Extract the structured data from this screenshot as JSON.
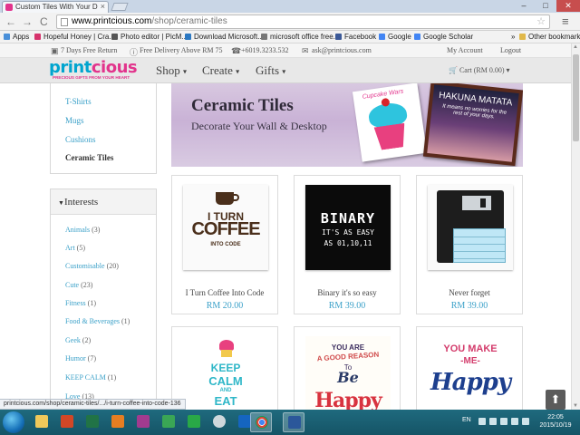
{
  "browser": {
    "tab_title": "Custom Tiles With Your D",
    "tab_close": "×",
    "win_min": "–",
    "win_max": "□",
    "win_close": "✕",
    "nav_back": "←",
    "nav_forward": "→",
    "nav_reload": "C",
    "url_host": "www.printcious.com",
    "url_path": "/shop/ceramic-tiles",
    "star": "☆",
    "menu": "≡",
    "bookmarks": [
      {
        "label": "Apps",
        "color": "#4a90d9"
      },
      {
        "label": "Hopeful Honey | Cra...",
        "color": "#d6336c"
      },
      {
        "label": "Photo editor | PicM...",
        "color": "#555555"
      },
      {
        "label": "Download Microsoft...",
        "color": "#2b78c2"
      },
      {
        "label": "microsoft office free...",
        "color": "#777777"
      },
      {
        "label": "Facebook",
        "color": "#3b5998"
      },
      {
        "label": "Google",
        "color": "#4285f4"
      },
      {
        "label": "Google Scholar",
        "color": "#4285f4"
      }
    ],
    "bm_overflow": "»",
    "other_bookmarks": "Other bookmarks",
    "status_url": "printcious.com/shop/ceramic-tiles/.../i-turn-coffee-into-code-136"
  },
  "topbar": {
    "return": "7 Days Free Return",
    "delivery": "Free Delivery Above RM 75",
    "phone": "+6019.3233.532",
    "email": "ask@printcious.com",
    "account": "My Account",
    "logout": "Logout"
  },
  "header": {
    "logo_main": "print",
    "logo_accent": "cious",
    "logo_tag": "PRECIOUS GIFTS FROM YOUR HEART",
    "nav_shop": "Shop",
    "nav_create": "Create",
    "nav_gifts": "Gifts",
    "cart": "Cart (RM 0.00)"
  },
  "sidebar": {
    "categories": [
      "T-Shirts",
      "Mugs",
      "Cushions",
      "Ceramic Tiles"
    ],
    "interests_title": "Interests",
    "interests": [
      {
        "label": "Animals",
        "count": "(3)"
      },
      {
        "label": "Art",
        "count": "(5)"
      },
      {
        "label": "Customisable",
        "count": "(20)"
      },
      {
        "label": "Cute",
        "count": "(23)"
      },
      {
        "label": "Fitness",
        "count": "(1)"
      },
      {
        "label": "Food & Beverages",
        "count": "(1)"
      },
      {
        "label": "Geek",
        "count": "(2)"
      },
      {
        "label": "Humor",
        "count": "(7)"
      },
      {
        "label": "KEEP CALM",
        "count": "(1)"
      },
      {
        "label": "Love",
        "count": "(13)"
      }
    ]
  },
  "banner": {
    "title": "Ceramic Tiles",
    "subtitle": "Decorate Your Wall & Desktop",
    "tile_caption": "Cupcake Wars",
    "frame_title": "HAKUNA MATATA",
    "frame_small": "It means no worries for the rest of your days."
  },
  "products": [
    {
      "name": "I Turn Coffee Into Code",
      "price": "RM 20.00"
    },
    {
      "name": "Binary it's so easy",
      "price": "RM 39.00"
    },
    {
      "name": "Never forget",
      "price": "RM 39.00"
    }
  ],
  "tiles": {
    "coffee_l1": "I TURN",
    "coffee_l2": "COFFEE",
    "coffee_l3": "INTO CODE",
    "binary_l1": "BINARY",
    "binary_l2": "IT'S AS EASY",
    "binary_l3": "AS 01,10,11",
    "keep_l1": "KEEP",
    "keep_l2": "CALM",
    "keep_l3": "AND",
    "keep_l4": "EAT",
    "reason_l1": "YOU ARE",
    "reason_l2": "A GOOD REASON",
    "reason_l3": "To",
    "reason_l4": "Be",
    "reason_l5": "Happy",
    "make_l1": "YOU MAKE",
    "make_l2": "-ME-",
    "make_l3": "Happy"
  },
  "taskbar": {
    "lang": "EN",
    "time": "22:05",
    "date": "2015/10/19"
  },
  "backtop": "⬆"
}
